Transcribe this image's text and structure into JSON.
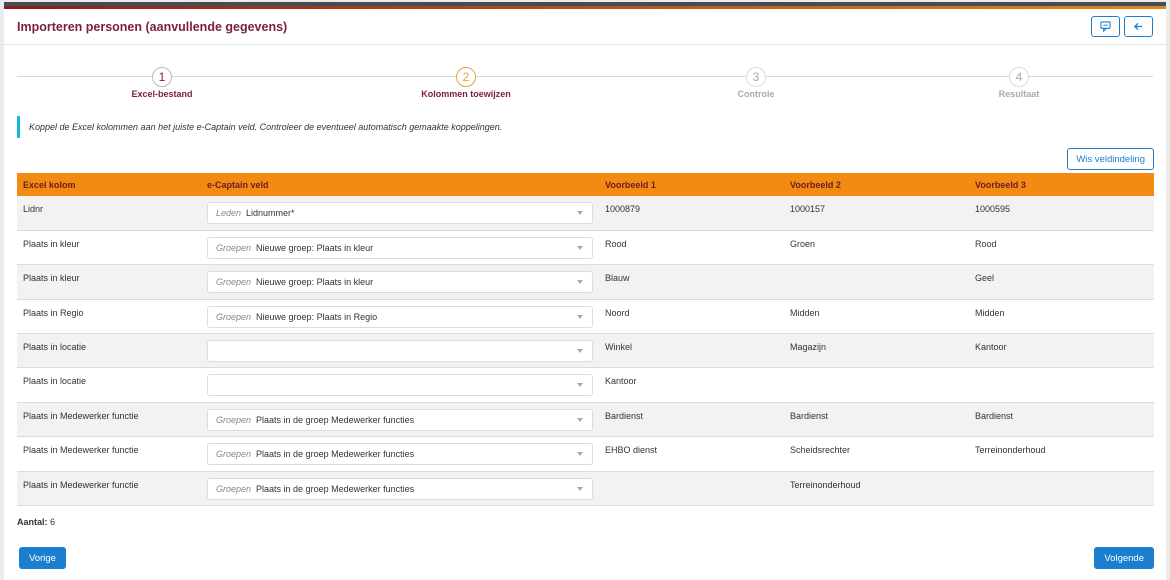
{
  "header": {
    "title": "Importeren personen (aanvullende gegevens)"
  },
  "icons": {
    "comment": "comment-icon",
    "back": "arrow-left-icon"
  },
  "steps": [
    {
      "num": "1",
      "label": "Excel-bestand",
      "state": "done"
    },
    {
      "num": "2",
      "label": "Kolommen toewijzen",
      "state": "active"
    },
    {
      "num": "3",
      "label": "Controle",
      "state": "todo"
    },
    {
      "num": "4",
      "label": "Resultaat",
      "state": "todo"
    }
  ],
  "info_text": "Koppel de Excel kolommen aan het juiste e-Captain veld. Controleer de eventueel automatisch gemaakte koppelingen.",
  "clear_button": "Wis veldindeling",
  "table": {
    "headers": [
      "Excel kolom",
      "e-Captain veld",
      "Voorbeeld 1",
      "Voorbeeld 2",
      "Voorbeeld 3"
    ],
    "rows": [
      {
        "col": "Lidnr",
        "cat": "Leden",
        "field": "Lidnummer*",
        "v1": "1000879",
        "v2": "1000157",
        "v3": "1000595"
      },
      {
        "col": "Plaats in kleur",
        "cat": "Groepen",
        "field": "Nieuwe groep: Plaats in kleur",
        "v1": "Rood",
        "v2": "Groen",
        "v3": "Rood"
      },
      {
        "col": "Plaats in kleur",
        "cat": "Groepen",
        "field": "Nieuwe groep: Plaats in kleur",
        "v1": "Blauw",
        "v2": "",
        "v3": "Geel"
      },
      {
        "col": "Plaats in Regio",
        "cat": "Groepen",
        "field": "Nieuwe groep: Plaats in Regio",
        "v1": "Noord",
        "v2": "Midden",
        "v3": "Midden"
      },
      {
        "col": "Plaats in locatie",
        "cat": "",
        "field": "",
        "v1": "Winkel",
        "v2": "Magazijn",
        "v3": "Kantoor"
      },
      {
        "col": "Plaats in locatie",
        "cat": "",
        "field": "",
        "v1": "Kantoor",
        "v2": "",
        "v3": ""
      },
      {
        "col": "Plaats in Medewerker functie",
        "cat": "Groepen",
        "field": "Plaats in de groep Medewerker functies",
        "v1": "Bardienst",
        "v2": "Bardienst",
        "v3": "Bardienst"
      },
      {
        "col": "Plaats in Medewerker functie",
        "cat": "Groepen",
        "field": "Plaats in de groep Medewerker functies",
        "v1": "EHBO dienst",
        "v2": "Scheidsrechter",
        "v3": "Terreinonderhoud"
      },
      {
        "col": "Plaats in Medewerker functie",
        "cat": "Groepen",
        "field": "Plaats in de groep Medewerker functies",
        "v1": "",
        "v2": "Terreinonderhoud",
        "v3": ""
      }
    ]
  },
  "count": {
    "label": "Aantal:",
    "value": "6"
  },
  "nav": {
    "prev": "Vorige",
    "next": "Volgende"
  },
  "colors": {
    "accent": "#1b7fd1",
    "table_header": "#f38a12",
    "title": "#7a1f3d",
    "info_border": "#17b5d8"
  }
}
